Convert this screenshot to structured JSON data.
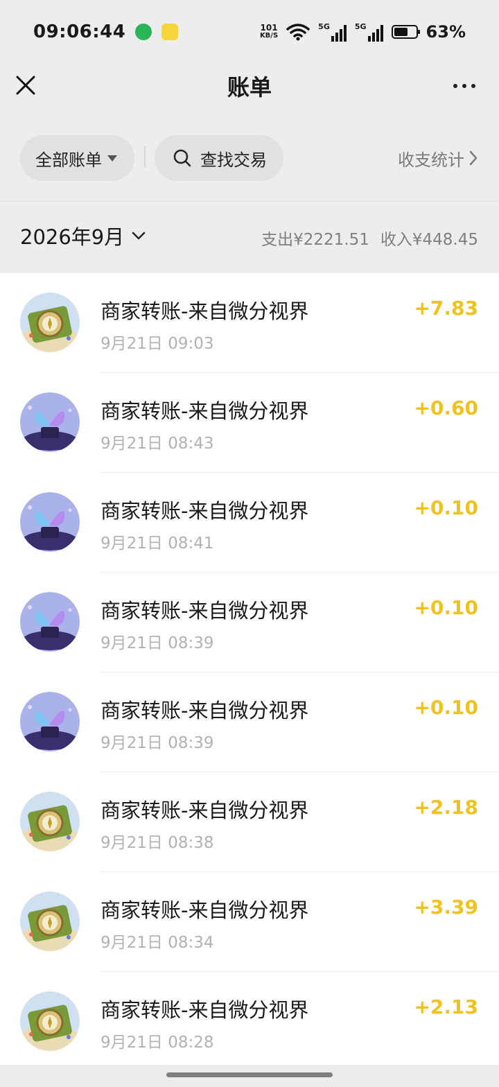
{
  "status_bar": {
    "time": "09:06:44",
    "net_speed_value": "101",
    "net_speed_unit": "KB/S",
    "signal_1": "5G",
    "signal_2": "5G",
    "battery_level": 0.63,
    "battery_text": "63%"
  },
  "nav": {
    "title": "账单",
    "close_icon": "close-icon",
    "more_icon": "more-icon"
  },
  "filters": {
    "all_bills_label": "全部账单",
    "search_label": "查找交易",
    "stats_label": "收支统计"
  },
  "month": {
    "label": "2026年9月",
    "expense_label": "支出",
    "expense_value": "¥2221.51",
    "income_label": "收入",
    "income_value": "¥448.45"
  },
  "colors": {
    "amount": "#f0c21d",
    "background": "#ededed"
  },
  "transactions": [
    {
      "title": "商家转账-来自微分视界",
      "time": "9月21日 09:03",
      "amount": "+7.83",
      "avatar": "compass"
    },
    {
      "title": "商家转账-来自微分视界",
      "time": "9月21日 08:43",
      "amount": "+0.60",
      "avatar": "butterfly"
    },
    {
      "title": "商家转账-来自微分视界",
      "time": "9月21日 08:41",
      "amount": "+0.10",
      "avatar": "butterfly"
    },
    {
      "title": "商家转账-来自微分视界",
      "time": "9月21日 08:39",
      "amount": "+0.10",
      "avatar": "butterfly"
    },
    {
      "title": "商家转账-来自微分视界",
      "time": "9月21日 08:39",
      "amount": "+0.10",
      "avatar": "butterfly"
    },
    {
      "title": "商家转账-来自微分视界",
      "time": "9月21日 08:38",
      "amount": "+2.18",
      "avatar": "compass"
    },
    {
      "title": "商家转账-来自微分视界",
      "time": "9月21日 08:34",
      "amount": "+3.39",
      "avatar": "compass"
    },
    {
      "title": "商家转账-来自微分视界",
      "time": "9月21日 08:28",
      "amount": "+2.13",
      "avatar": "compass"
    }
  ]
}
